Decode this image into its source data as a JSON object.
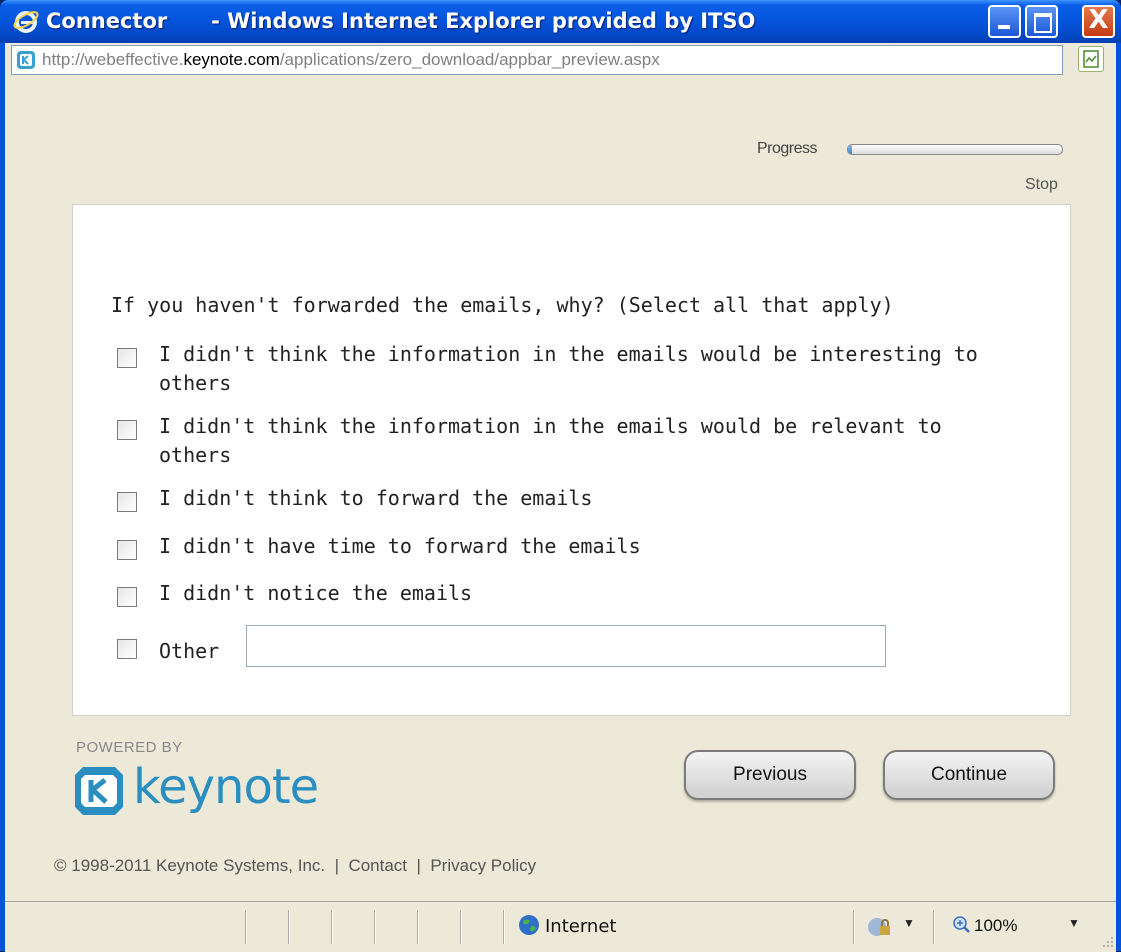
{
  "window": {
    "title": "Connector      - Windows Internet Explorer provided by ITSO",
    "close_glyph": "X"
  },
  "address": {
    "url_prefix": "http://webeffective.",
    "url_domain": "keynote.com",
    "url_path": "/applications/zero_download/appbar_preview.aspx"
  },
  "toolbar": {
    "progress_label": "Progress",
    "progress_fraction": 0.02,
    "stop_label": "Stop"
  },
  "survey": {
    "question": "If you haven't forwarded the emails, why? (Select all that apply)",
    "options": [
      {
        "label": "I didn't think the information in the emails would be interesting to others",
        "checked": false
      },
      {
        "label": "I didn't think the information in the emails would be relevant to others",
        "checked": false
      },
      {
        "label": "I didn't think to forward the emails",
        "checked": false
      },
      {
        "label": "I didn't have time to forward the emails",
        "checked": false
      },
      {
        "label": "I didn't notice the emails",
        "checked": false
      },
      {
        "label": "Other",
        "checked": false
      }
    ],
    "other_value": ""
  },
  "branding": {
    "powered_by": "POWERED BY",
    "logo_text": "keynote",
    "brand_color": "#2a8fc0"
  },
  "navigation": {
    "previous_label": "Previous",
    "continue_label": "Continue"
  },
  "footer": {
    "text": "© 1998-2011 Keynote Systems, Inc.  |  Contact  |  Privacy Policy"
  },
  "status": {
    "zone": "Internet",
    "zoom": "100%"
  }
}
